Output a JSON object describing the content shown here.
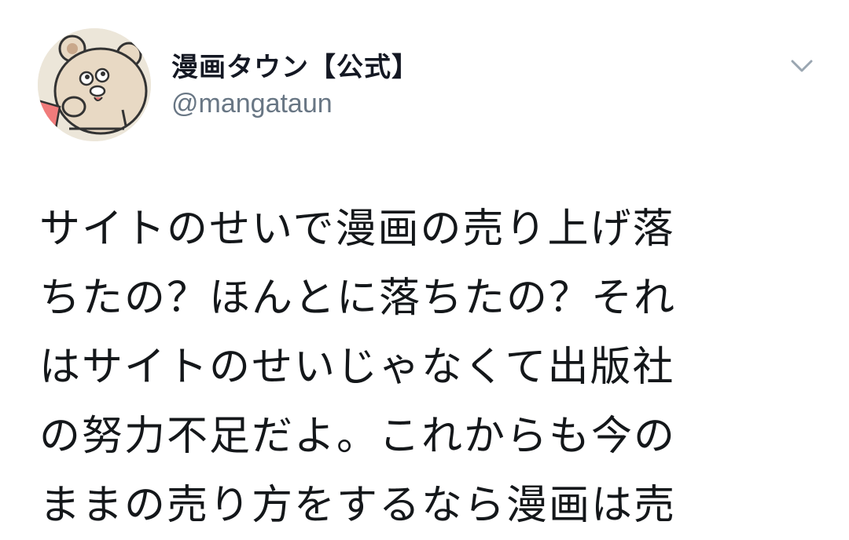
{
  "tweet": {
    "author": {
      "display_name": "漫画タウン【公式】",
      "handle": "@mangataun",
      "avatar_icon": "bear-avatar-icon"
    },
    "menu_icon": "chevron-down-icon",
    "text_lines": [
      "サイトのせいで漫画の売り上げ落",
      "ちたの？ほんとに落ちたの？それ",
      "はサイトのせいじゃなくて出版社",
      "の努力不足だよ。これからも今の",
      "ままの売り方をするなら漫画は売"
    ]
  }
}
